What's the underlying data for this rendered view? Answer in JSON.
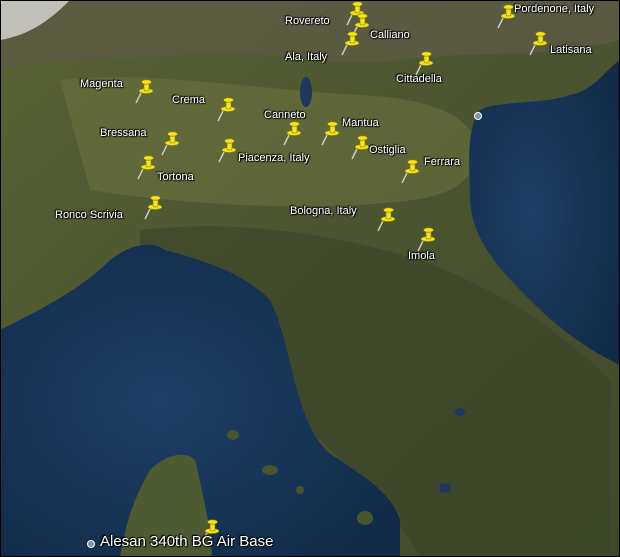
{
  "map": {
    "places": [
      {
        "id": "rovereto",
        "label": "Rovereto"
      },
      {
        "id": "calliano",
        "label": "Calliano"
      },
      {
        "id": "ala",
        "label": "Ala, Italy"
      },
      {
        "id": "pordenone",
        "label": "Pordenone, Italy"
      },
      {
        "id": "latisana",
        "label": "Latisana"
      },
      {
        "id": "cittadella",
        "label": "Cittadella"
      },
      {
        "id": "magenta",
        "label": "Magenta"
      },
      {
        "id": "crema",
        "label": "Crema"
      },
      {
        "id": "canneto",
        "label": "Canneto"
      },
      {
        "id": "mantua",
        "label": "Mantua"
      },
      {
        "id": "bressana",
        "label": "Bressana"
      },
      {
        "id": "piacenza",
        "label": "Piacenza, Italy"
      },
      {
        "id": "ostiglia",
        "label": "Ostiglia"
      },
      {
        "id": "ferrara",
        "label": "Ferrara"
      },
      {
        "id": "tortona",
        "label": "Tortona"
      },
      {
        "id": "ronco",
        "label": "Ronco Scrivia"
      },
      {
        "id": "bologna",
        "label": "Bologna, Italy"
      },
      {
        "id": "imola",
        "label": "Imola"
      },
      {
        "id": "alesan",
        "label": "Alesan 340th BG Air Base"
      }
    ],
    "colors": {
      "sea": "#17324f",
      "land": "#4d5731",
      "pin": "#f3e21d",
      "label": "#ffffff"
    }
  }
}
